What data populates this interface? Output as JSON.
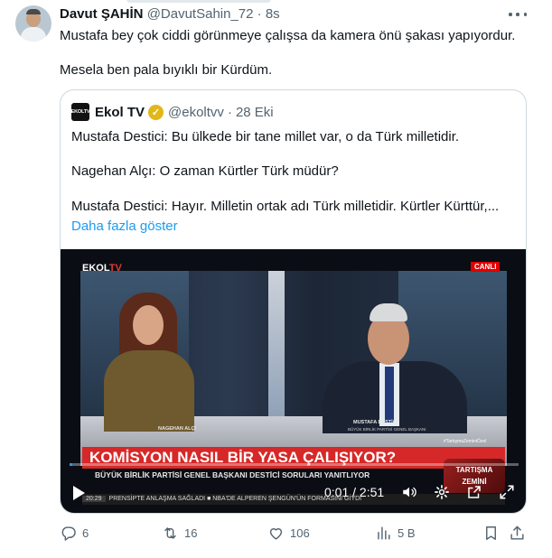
{
  "tweet": {
    "author_name": "Davut ŞAHİN",
    "author_handle": "@DavutSahin_72",
    "separator": "·",
    "time": "8s",
    "lines": [
      "Mustafa bey çok ciddi görünmeye çalışsa da kamera önü şakası yapıyordur.",
      "Mesela ben pala bıyıklı bir Kürdüm."
    ]
  },
  "quote": {
    "logo_text": "EKOLTV",
    "author_name": "Ekol TV",
    "author_handle": "@ekoltvv",
    "separator": "·",
    "date": "28 Eki",
    "lines": [
      "Mustafa Destici: Bu ülkede bir tane millet var, o da Türk milletidir.",
      "Nagehan Alçı: O zaman Kürtler Türk müdür?",
      "Mustafa Destici: Hayır. Milletin ortak adı Türk milletidir. Kürtler Kürttür,..."
    ],
    "show_more": "Daha fazla göster"
  },
  "video": {
    "channel_logo_main": "EKOL",
    "channel_logo_accent": "TV",
    "live_badge": "CANLI",
    "guest_left_name": "NAGEHAN ALÇI",
    "guest_right_name": "MUSTAFA DESTİCİ",
    "guest_right_title": "BÜYÜK BİRLİK PARTİSİ GENEL BAŞKANI",
    "hashtag": "#TartışmaZeminiÖzel",
    "headline": "KOMİSYON NASIL BİR YASA ÇALIŞIYOR?",
    "subheadline": "BÜYÜK BİRLİK PARTİSİ GENEL BAŞKANI DESTİCİ SORULARI YANITLIYOR",
    "ticker_time": "20:29",
    "ticker_text": "PRENSİPTE ANLAŞMA SAĞLADI  ■  NBA'DE ALPEREN ŞENGÜN'ÜN FORMASINI GİYDİ",
    "show_badge_line1": "TARTIŞMA",
    "show_badge_line2": "ZEMİNİ",
    "timecode": "0:01 / 2:51",
    "progress_fraction": 0.006
  },
  "actions": {
    "replies": "6",
    "retweets": "16",
    "likes": "106",
    "views": "5 B"
  },
  "colors": {
    "accent_blue": "#1d9bf0",
    "text_secondary": "#536471",
    "verified_gold": "#e2b719",
    "live_red": "#e00000"
  }
}
